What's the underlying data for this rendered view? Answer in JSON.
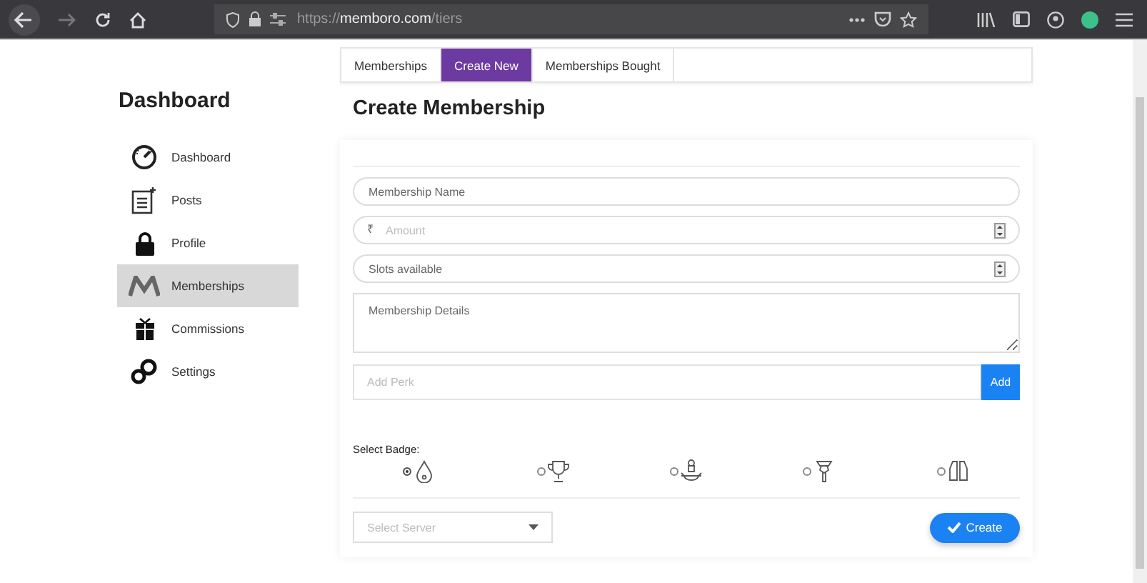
{
  "browser": {
    "url_prefix": "https://",
    "url_host": "memboro.com",
    "url_path": "/tiers"
  },
  "sidebar": {
    "title": "Dashboard",
    "items": [
      {
        "label": "Dashboard",
        "selected": false
      },
      {
        "label": "Posts",
        "selected": false
      },
      {
        "label": "Profile",
        "selected": false
      },
      {
        "label": "Memberships",
        "selected": true
      },
      {
        "label": "Commissions",
        "selected": false
      },
      {
        "label": "Settings",
        "selected": false
      }
    ]
  },
  "tabs": [
    {
      "label": "Memberships",
      "selected": false
    },
    {
      "label": "Create New",
      "selected": true
    },
    {
      "label": "Memberships Bought",
      "selected": false
    }
  ],
  "heading": "Create Membership",
  "form": {
    "name": {
      "placeholder": "Membership Name"
    },
    "amount": {
      "currency": "₹",
      "placeholder": "Amount"
    },
    "slots": {
      "placeholder": "Slots available"
    },
    "details": {
      "placeholder": "Membership Details"
    },
    "perk": {
      "placeholder": "Add Perk",
      "button": "Add"
    },
    "badge_label": "Select Badge:",
    "badges": [
      {
        "selected": true
      },
      {
        "selected": false
      },
      {
        "selected": false
      },
      {
        "selected": false
      },
      {
        "selected": false
      }
    ],
    "server": {
      "placeholder": "Select Server"
    },
    "create_button": "Create"
  }
}
